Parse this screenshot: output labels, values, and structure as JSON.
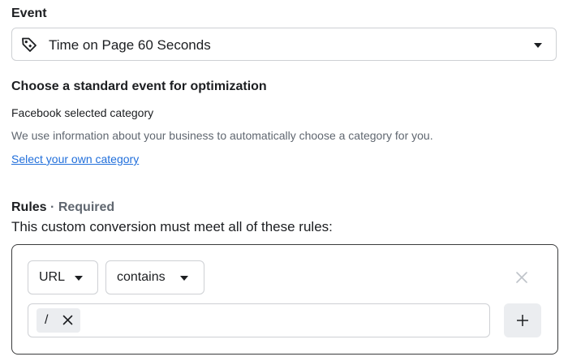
{
  "event": {
    "label": "Event",
    "selected": "Time on Page 60 Seconds",
    "icon": "tag-icon"
  },
  "optimization": {
    "title": "Choose a standard event for optimization",
    "selected_category": "Facebook selected category",
    "help_text": "We use information about your business to automatically choose a category for you.",
    "link_label": "Select your own category"
  },
  "rules": {
    "title": "Rules",
    "separator": "·",
    "required_label": "Required",
    "subtitle": "This custom conversion must meet all of these rules:",
    "rule": {
      "field": "URL",
      "operator": "contains",
      "values": [
        "/"
      ]
    }
  },
  "colors": {
    "link": "#216fdb",
    "muted_text": "#606770",
    "border": "#ced0d4",
    "chip_bg": "#ebedf0"
  }
}
